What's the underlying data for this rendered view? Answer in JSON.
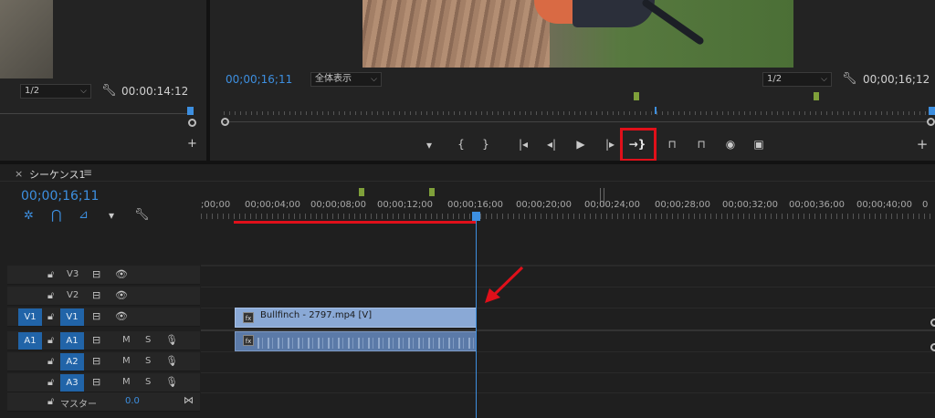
{
  "source_monitor": {
    "zoom": "1/2",
    "timecode": "00:00:14:12"
  },
  "program_monitor": {
    "timecode_current": "00;00;16;11",
    "fit": "全体表示",
    "zoom": "1/2",
    "timecode_duration": "00;00;16;12"
  },
  "transport": {
    "marker": "▾",
    "in": "{",
    "out": "}",
    "goto_in": "|◂",
    "step_back": "◂|",
    "play": "▶",
    "step_fwd": "|▸",
    "goto_out": "→}",
    "lift": "⊓",
    "extract": "⊓",
    "export_frame": "◉",
    "compare": "▣",
    "add": "+"
  },
  "sequence": {
    "close": "×",
    "name": "シーケンス1",
    "menu": "≡",
    "timecode": "00;00;16;11"
  },
  "ruler": {
    "labels": [
      ";00;00",
      "00;00;04;00",
      "00;00;08;00",
      "00;00;12;00",
      "00;00;16;00",
      "00;00;20;00",
      "00;00;24;00",
      "00;00;28;00",
      "00;00;32;00",
      "00;00;36;00",
      "00;00;40;00",
      "0"
    ]
  },
  "tracks": {
    "video": [
      {
        "name": "V3",
        "source": ""
      },
      {
        "name": "V2",
        "source": ""
      },
      {
        "name": "V1",
        "source": "V1"
      }
    ],
    "audio": [
      {
        "name": "A1",
        "source": "A1",
        "m": "M",
        "s": "S"
      },
      {
        "name": "A2",
        "source": "",
        "m": "M",
        "s": "S"
      },
      {
        "name": "A3",
        "source": "",
        "m": "M",
        "s": "S"
      }
    ],
    "master_label": "マスター",
    "master_value": "0.0"
  },
  "clip": {
    "video_label": "Bullfinch - 2797.mp4 [V]",
    "fx": "fx"
  },
  "colors": {
    "accent_blue": "#3d8fe0",
    "highlight_red": "#e0101a",
    "clip_video": "#8aa9d6",
    "clip_audio": "#5b7aa8",
    "marker_green": "#7fa03a"
  }
}
